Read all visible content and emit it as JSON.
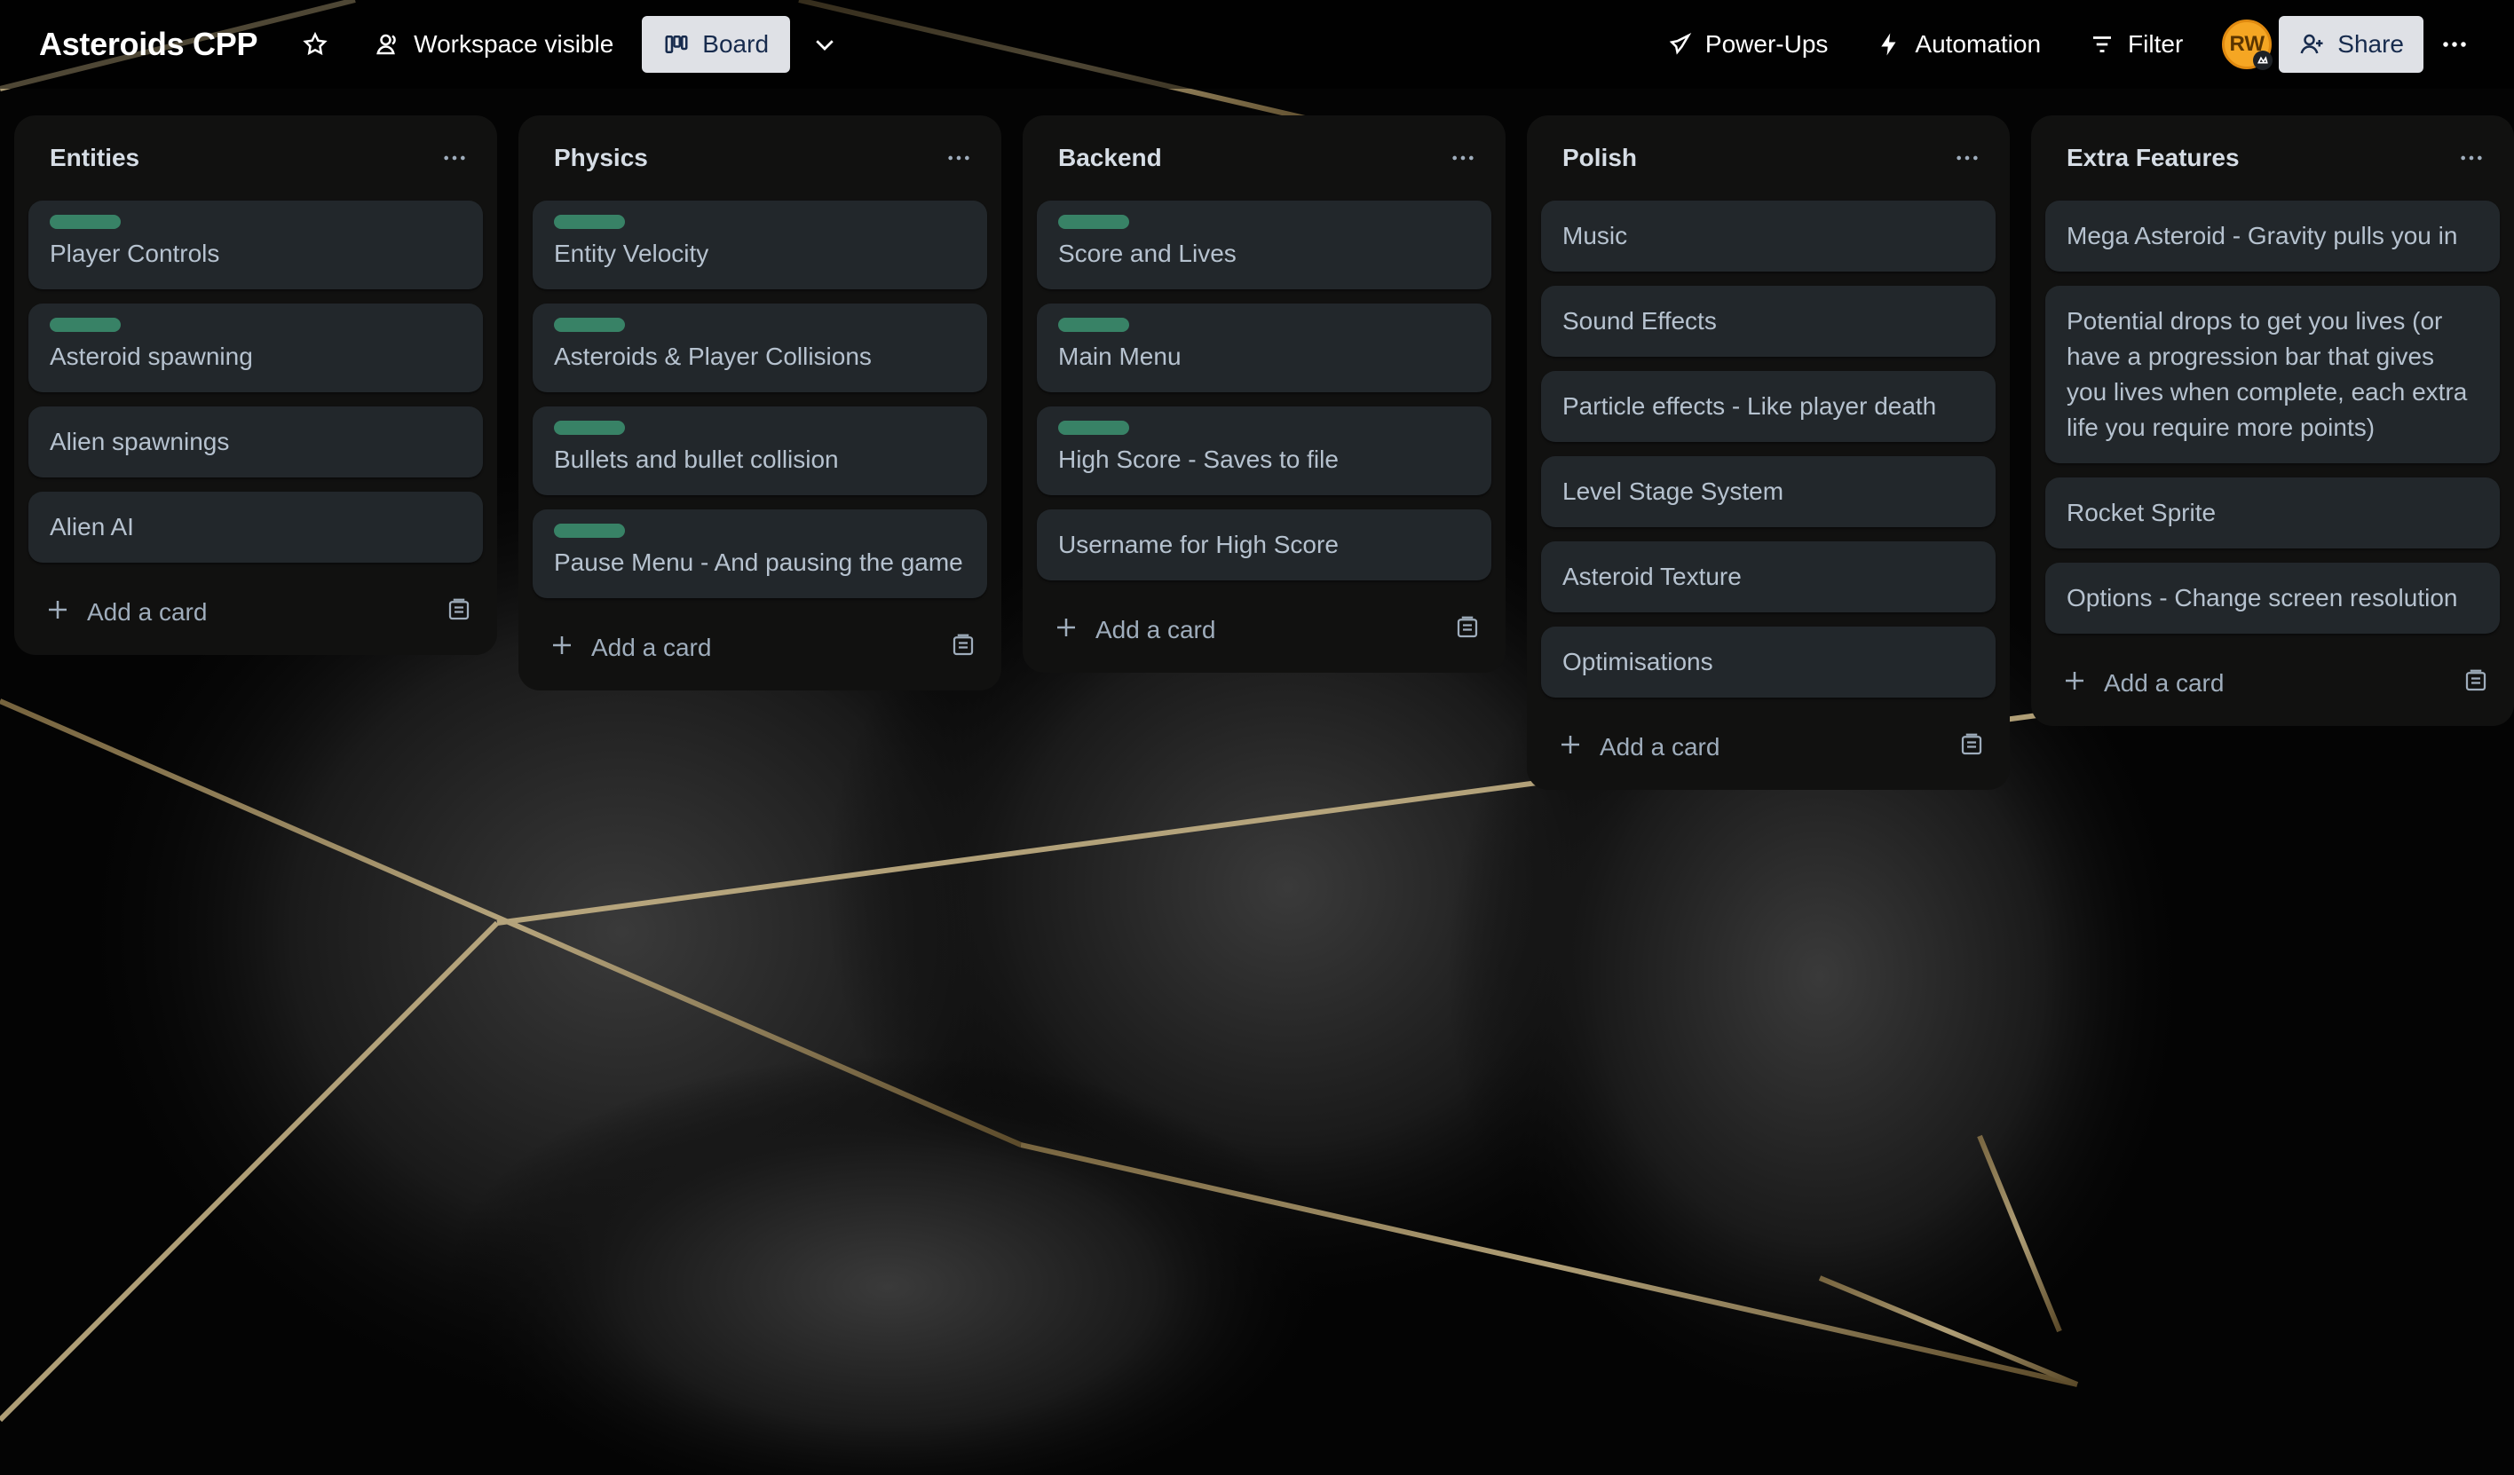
{
  "header": {
    "board_title": "Asteroids CPP",
    "star_icon": "star-icon",
    "visibility_label": "Workspace visible",
    "view_label": "Board",
    "powerups_label": "Power-Ups",
    "automation_label": "Automation",
    "filter_label": "Filter",
    "avatar_initials": "RW",
    "share_label": "Share"
  },
  "colors": {
    "label_green": "#4bce97",
    "list_bg": "#111110",
    "card_bg": "#22272b",
    "avatar": "#f5a623"
  },
  "add_card_label": "Add a card",
  "lists": [
    {
      "title": "Entities",
      "cards": [
        {
          "text": "Player Controls",
          "label": "green"
        },
        {
          "text": "Asteroid spawning",
          "label": "green"
        },
        {
          "text": "Alien spawnings"
        },
        {
          "text": "Alien AI"
        }
      ]
    },
    {
      "title": "Physics",
      "cards": [
        {
          "text": "Entity Velocity",
          "label": "green"
        },
        {
          "text": "Asteroids & Player Collisions",
          "label": "green"
        },
        {
          "text": "Bullets and bullet collision",
          "label": "green"
        },
        {
          "text": "Pause Menu - And pausing the game",
          "label": "green"
        }
      ]
    },
    {
      "title": "Backend",
      "cards": [
        {
          "text": "Score and Lives",
          "label": "green"
        },
        {
          "text": "Main Menu",
          "label": "green"
        },
        {
          "text": "High Score - Saves to file",
          "label": "green"
        },
        {
          "text": "Username for High Score"
        }
      ]
    },
    {
      "title": "Polish",
      "cards": [
        {
          "text": "Music"
        },
        {
          "text": "Sound Effects"
        },
        {
          "text": "Particle effects - Like player death"
        },
        {
          "text": "Level Stage System"
        },
        {
          "text": "Asteroid Texture"
        },
        {
          "text": "Optimisations"
        }
      ]
    },
    {
      "title": "Extra Features",
      "cards": [
        {
          "text": "Mega Asteroid - Gravity pulls you in"
        },
        {
          "text": "Potential drops to get you lives (or have a progression bar that gives you lives when complete, each extra life you require more points)"
        },
        {
          "text": "Rocket Sprite"
        },
        {
          "text": "Options - Change screen resolution"
        }
      ]
    }
  ]
}
